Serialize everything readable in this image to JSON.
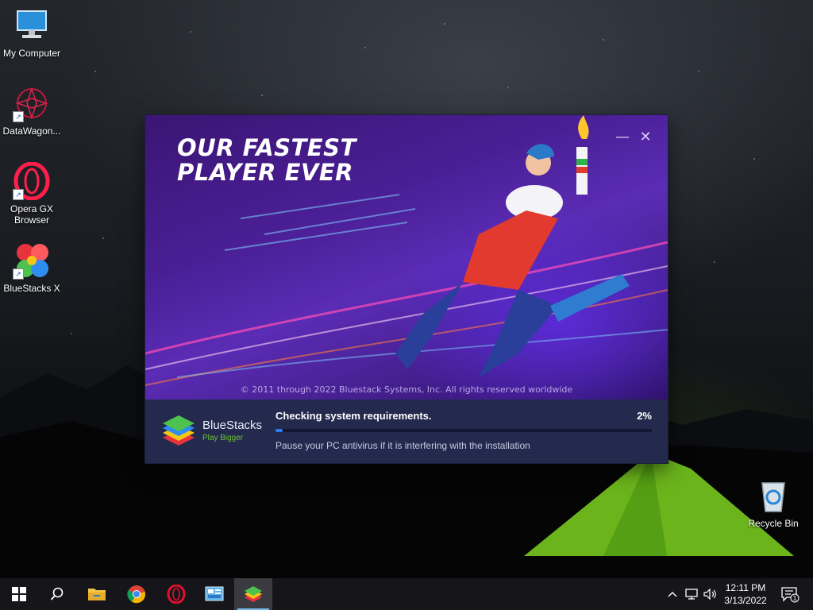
{
  "desktop": {
    "icons": [
      {
        "label": "My Computer"
      },
      {
        "label": "DataWagon..."
      },
      {
        "label": "Opera GX Browser"
      },
      {
        "label": "BlueStacks X"
      },
      {
        "label": "Recycle Bin"
      }
    ]
  },
  "installer": {
    "headline_line1": "OUR FASTEST",
    "headline_line2": "PLAYER EVER",
    "copyright": "© 2011 through 2022 Bluestack Systems, Inc. All rights reserved worldwide",
    "minimize_label": "—",
    "close_label": "✕",
    "brand_name": "BlueStacks",
    "brand_tagline": "Play Bigger",
    "status_text": "Checking system requirements.",
    "progress_percent_text": "2%",
    "progress_fraction": 0.02,
    "hint_text": "Pause your PC antivirus if it is interfering with the installation"
  },
  "taskbar": {
    "apps": [
      {
        "icon": "start-icon"
      },
      {
        "icon": "search-icon"
      },
      {
        "icon": "file-explorer-icon"
      },
      {
        "icon": "chrome-icon"
      },
      {
        "icon": "opera-icon"
      },
      {
        "icon": "control-panel-icon"
      },
      {
        "icon": "bluestacks-icon",
        "active": true
      }
    ],
    "time": "12:11 PM",
    "date": "3/13/2022",
    "notification_count": "1"
  },
  "colors": {
    "accent": "#2f7cf0",
    "footer_bg": "#232a4e",
    "tagline_green": "#6fbf3b"
  }
}
